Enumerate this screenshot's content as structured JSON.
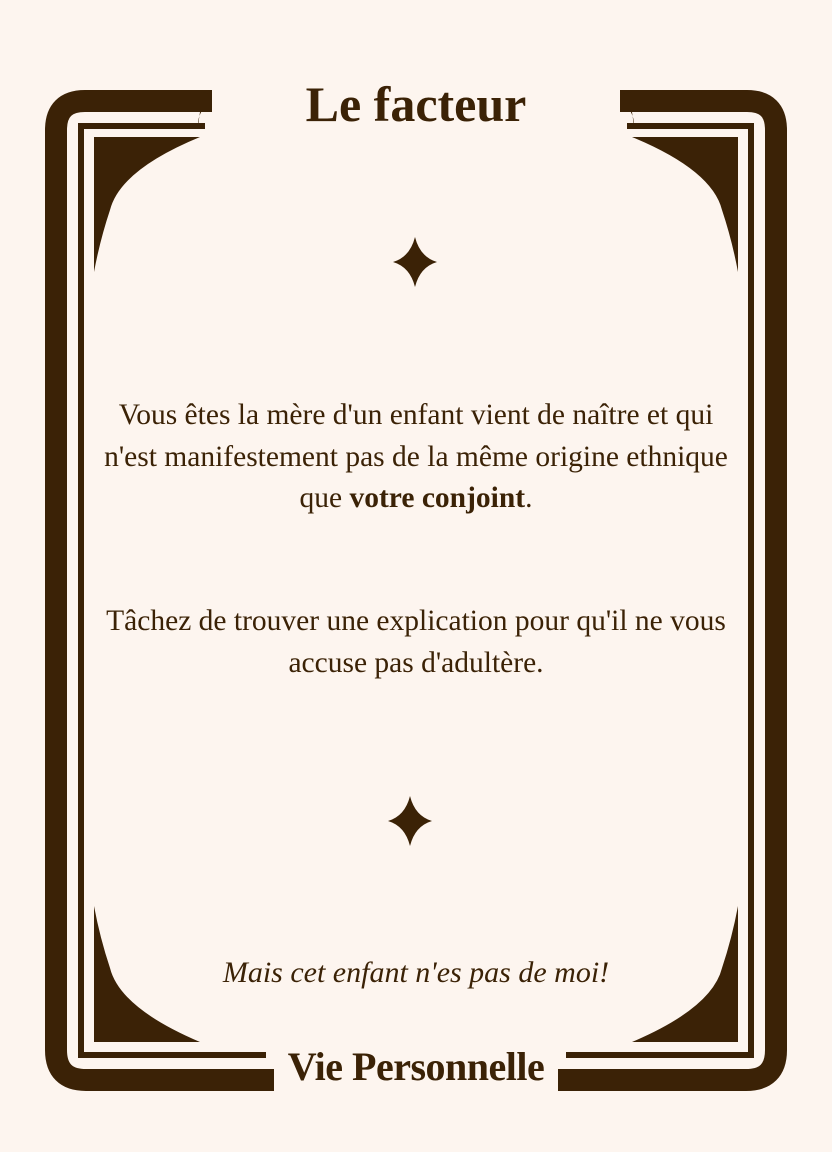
{
  "card": {
    "title": "Le facteur",
    "paragraph1": {
      "text_before": "Vous êtes la mère d'un enfant vient de naître et qui n'est manifestement pas de la même origine ethnique que ",
      "text_bold": "votre conjoint",
      "text_after": "."
    },
    "paragraph2": "Tâchez de trouver une explication pour qu'il ne vous accuse pas d'adultère.",
    "quote": "Mais cet enfant n'es pas de moi!",
    "category": "Vie Personnelle"
  },
  "icons": {
    "top_star": "four-point-star-icon",
    "bottom_star": "four-point-star-icon",
    "corners": "corner-ornament-icon"
  },
  "colors": {
    "background": "#fdf5ef",
    "ink": "#3b2206"
  }
}
